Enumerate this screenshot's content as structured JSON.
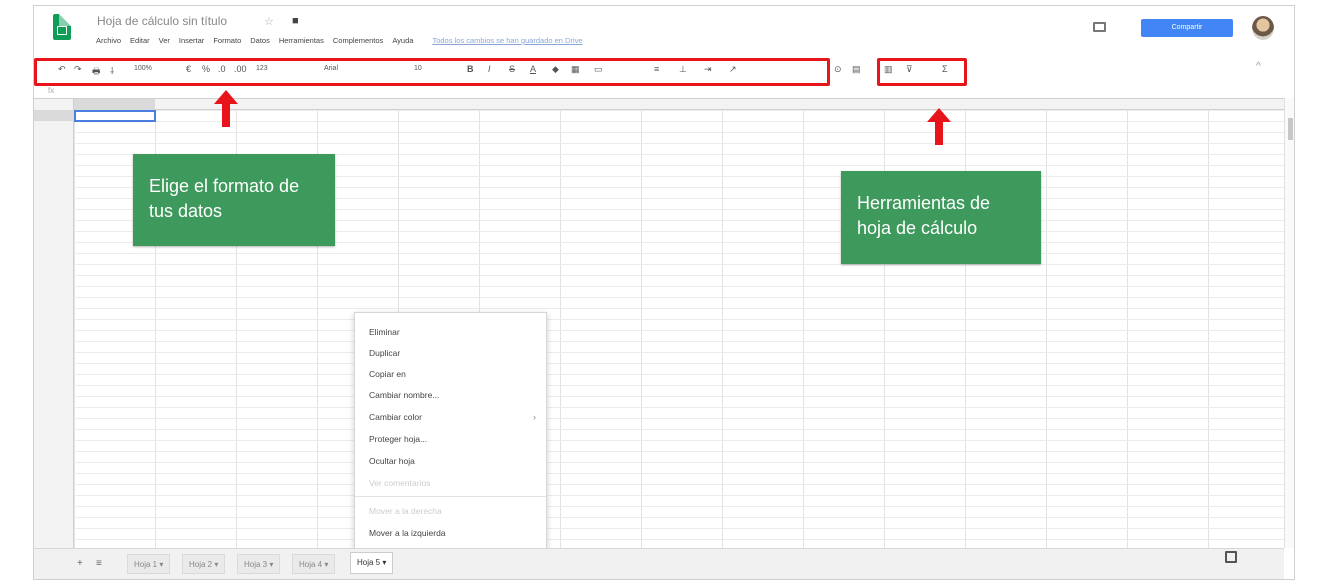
{
  "app": {
    "doc_title": "Hoja de cálculo sin título",
    "menu": [
      "Archivo",
      "Editar",
      "Ver",
      "Insertar",
      "Formato",
      "Datos",
      "Herramientas",
      "Complementos",
      "Ayuda"
    ],
    "saved_status": "Todos los cambios se han guardado en Drive",
    "share_label": "Compartir"
  },
  "toolbar": {
    "undo": "↶",
    "redo": "↷",
    "print": "🖶",
    "paint_format": "⸸",
    "zoom": "100%",
    "currency": "€",
    "percent": "%",
    "dec_less": ".0",
    "dec_more": ".00",
    "more_formats": "123",
    "font": "Arial",
    "font_size": "10",
    "bold": "B",
    "italic": "I",
    "strike": "S",
    "text_color": "A",
    "link": "⊙",
    "comment": "▤",
    "chart": "▥",
    "filter": "⊽",
    "functions": "Σ"
  },
  "callouts": {
    "format_text": "Elige el formato de tus datos",
    "tools_text": "Herramientas de hoja de cálculo"
  },
  "context_menu": {
    "items": [
      "Eliminar",
      "Duplicar",
      "Copiar en",
      "Cambiar nombre...",
      "Cambiar color",
      "Proteger hoja...",
      "Ocultar hoja",
      "Ver comentarios",
      "Mover a la derecha",
      "Mover a la izquierda"
    ],
    "disabled": [
      false,
      false,
      false,
      false,
      false,
      false,
      false,
      true,
      true,
      false
    ]
  },
  "sheets": [
    "Hoja 1",
    "Hoja 2",
    "Hoja 3",
    "Hoja 4",
    "Hoja 5"
  ],
  "active_sheet": "Hoja 5",
  "colors": {
    "callout_green": "#3e9a5c",
    "highlight_red": "#e8141b",
    "share_blue": "#4285f4"
  }
}
